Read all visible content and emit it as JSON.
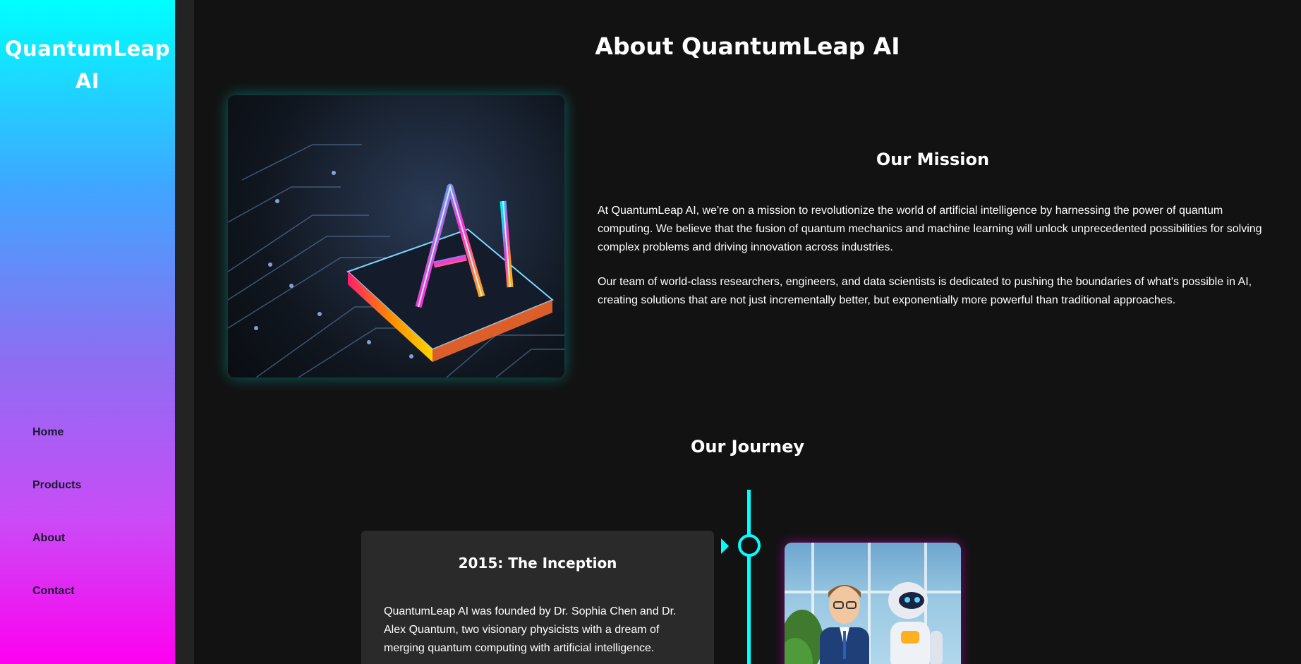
{
  "sidebar": {
    "brand": "QuantumLeap AI",
    "nav": [
      {
        "label": "Home"
      },
      {
        "label": "Products"
      },
      {
        "label": "About"
      },
      {
        "label": "Contact"
      }
    ]
  },
  "main": {
    "title": "About QuantumLeap AI",
    "mission": {
      "title": "Our Mission",
      "paragraphs": [
        "At QuantumLeap AI, we're on a mission to revolutionize the world of artificial intelligence by harnessing the power of quantum computing. We believe that the fusion of quantum mechanics and machine learning will unlock unprecedented possibilities for solving complex problems and driving innovation across industries.",
        "Our team of world-class researchers, engineers, and data scientists is dedicated to pushing the boundaries of what's possible in AI, creating solutions that are not just incrementally better, but exponentially more powerful than traditional approaches."
      ]
    },
    "journey": {
      "title": "Our Journey",
      "events": [
        {
          "title": "2015: The Inception",
          "description": "QuantumLeap AI was founded by Dr. Sophia Chen and Dr. Alex Quantum, two visionary physicists with a dream of merging quantum computing with artificial intelligence."
        }
      ]
    }
  },
  "colors": {
    "accent_cyan": "#00ffff",
    "accent_magenta": "#ff00f0",
    "background": "#121212",
    "card": "#2a2a2a"
  }
}
